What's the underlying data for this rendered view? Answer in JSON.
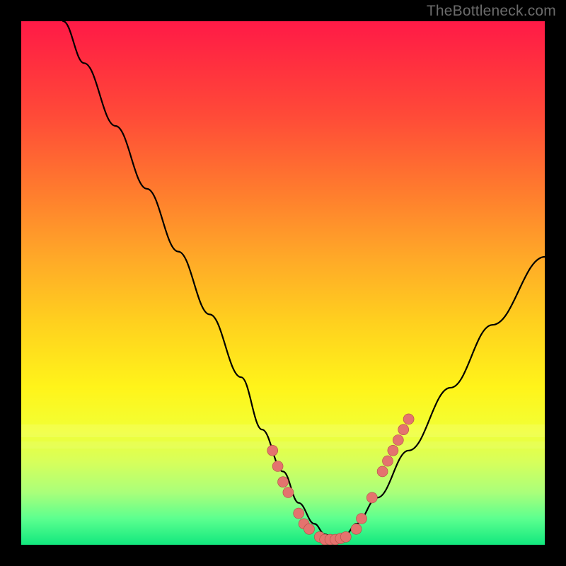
{
  "watermark": {
    "text": "TheBottleneck.com"
  },
  "chart_data": {
    "type": "line",
    "title": "",
    "xlabel": "",
    "ylabel": "",
    "xlim": [
      0,
      100
    ],
    "ylim": [
      0,
      100
    ],
    "grid": false,
    "legend": false,
    "series": [
      {
        "name": "bottleneck-curve",
        "x": [
          8,
          12,
          18,
          24,
          30,
          36,
          42,
          46,
          50,
          53,
          56,
          58,
          60,
          62,
          64,
          68,
          74,
          82,
          90,
          100
        ],
        "y": [
          100,
          92,
          80,
          68,
          56,
          44,
          32,
          22,
          14,
          8,
          4,
          2,
          1,
          2,
          4,
          9,
          18,
          30,
          42,
          55
        ]
      }
    ],
    "highlight_points": {
      "name": "highlighted-dots",
      "color": "#e4736e",
      "x": [
        48,
        49,
        50,
        51,
        53,
        54,
        55,
        57,
        58,
        59,
        60,
        61,
        62,
        64,
        65,
        67,
        69,
        70,
        71,
        72,
        73,
        74
      ],
      "y": [
        18,
        15,
        12,
        10,
        6,
        4,
        3,
        1.5,
        1,
        1,
        1,
        1.2,
        1.5,
        3,
        5,
        9,
        14,
        16,
        18,
        20,
        22,
        24
      ]
    },
    "background_gradient": {
      "top": "#ff1a47",
      "mid": "#ffd21e",
      "bottom": "#12e87e"
    }
  }
}
